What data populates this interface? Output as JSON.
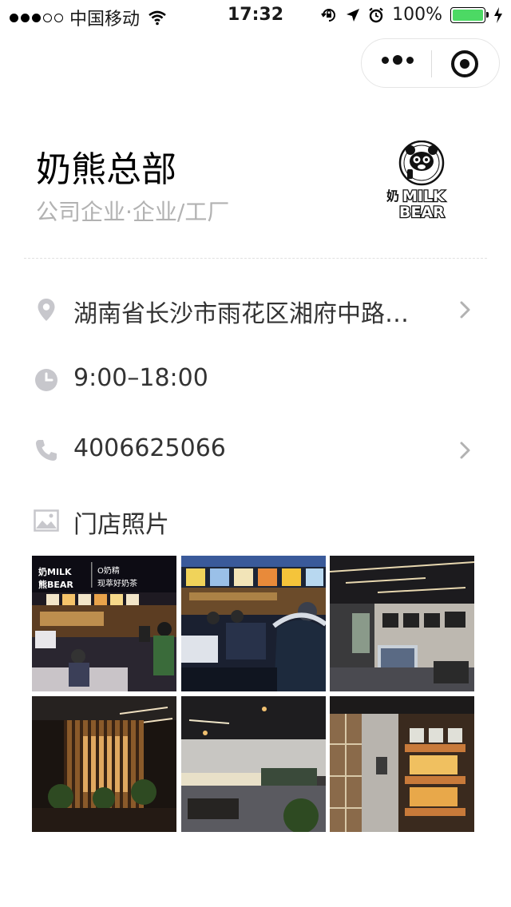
{
  "status_bar": {
    "carrier": "中国移动",
    "time": "17:32",
    "battery_percent": "100%"
  },
  "store": {
    "name": "奶熊总部",
    "category": "公司企业·企业/工厂",
    "logo_text_top": "MILK",
    "logo_text_bottom": "BEAR",
    "logo_side_text": "奶"
  },
  "info": {
    "address": "湖南省长沙市雨花区湘府中路…",
    "hours": "9:00–18:00",
    "phone": "4006625066"
  },
  "photos": {
    "label": "门店照片",
    "items": [
      {
        "sign_line1": "奶MILK",
        "sign_line2": "熊BEAR",
        "sign_right1": "O奶精",
        "sign_right2": "现萃好奶茶"
      },
      {},
      {},
      {},
      {},
      {}
    ]
  },
  "colors": {
    "battery_green": "#4cd964",
    "secondary_text": "#b2b2b2",
    "icon_gray": "#c7c7cc"
  }
}
